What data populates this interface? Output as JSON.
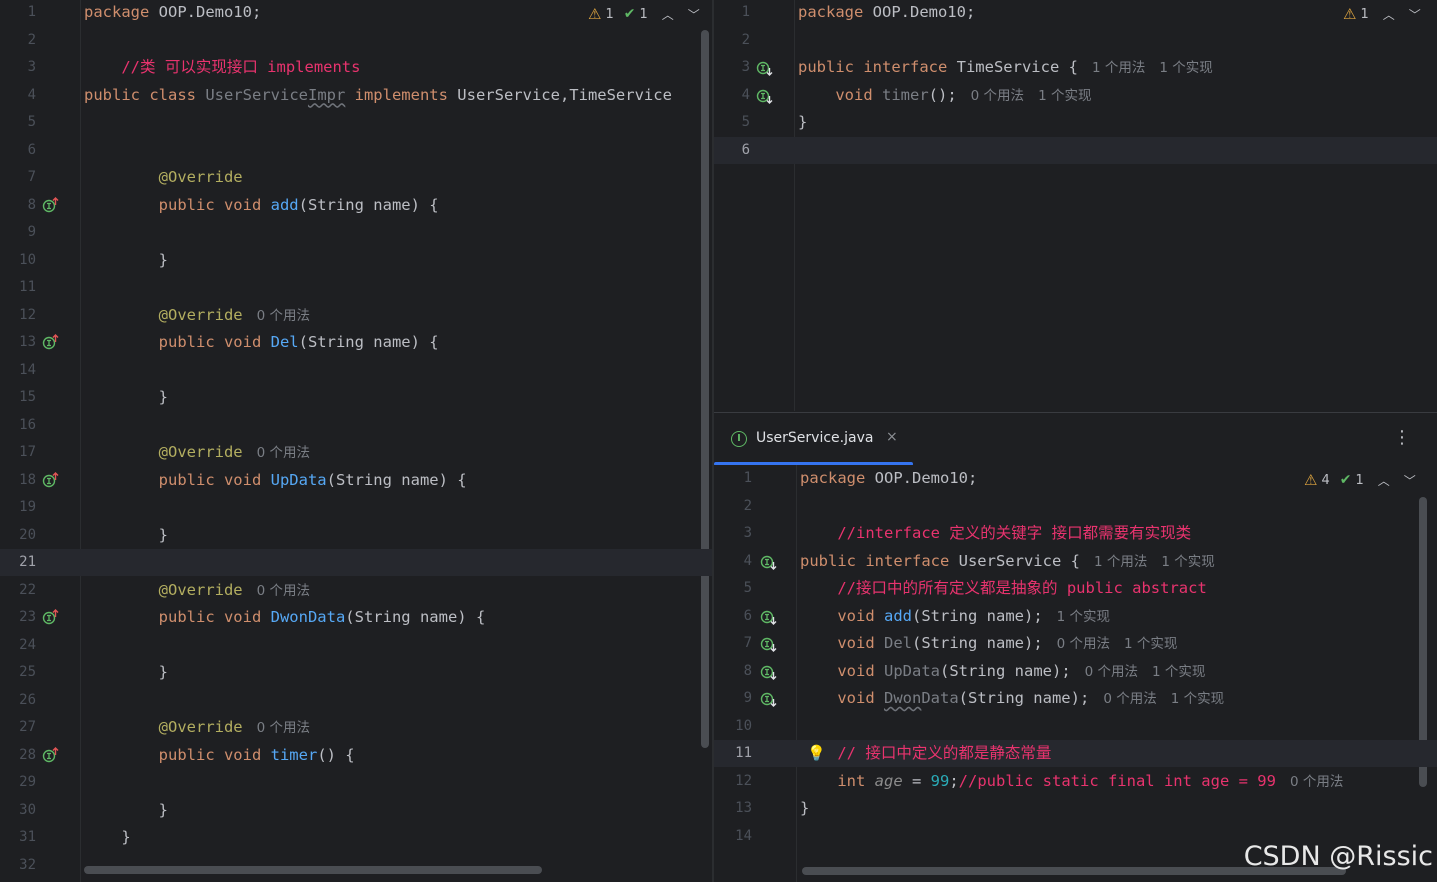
{
  "left_editor": {
    "inspections": {
      "warnings": "1",
      "checks": "1"
    },
    "lines": [
      {
        "n": "1",
        "tokens": [
          [
            "kw",
            "package "
          ],
          [
            "",
            "OOP.Demo10;"
          ]
        ]
      },
      {
        "n": "2",
        "tokens": []
      },
      {
        "n": "3",
        "indent": "    ",
        "tokens": [
          [
            "cm",
            "//类 可以实现接口 implements"
          ]
        ]
      },
      {
        "n": "4",
        "tokens": [
          [
            "kw",
            "public class "
          ],
          [
            "gray",
            "UserService"
          ],
          [
            "gray uw",
            "Impr"
          ],
          [
            "kw",
            " implements "
          ],
          [
            "",
            "UserService,TimeService"
          ]
        ]
      },
      {
        "n": "5",
        "tokens": []
      },
      {
        "n": "6",
        "tokens": []
      },
      {
        "n": "7",
        "indent": "        ",
        "tokens": [
          [
            "ann",
            "@Override"
          ]
        ]
      },
      {
        "n": "8",
        "indent": "        ",
        "icon": "override",
        "tokens": [
          [
            "kw",
            "public void "
          ],
          [
            "fn",
            "add"
          ],
          [
            "",
            "(String name) {"
          ]
        ]
      },
      {
        "n": "9",
        "tokens": []
      },
      {
        "n": "10",
        "indent": "        ",
        "tokens": [
          [
            "",
            "}"
          ]
        ]
      },
      {
        "n": "11",
        "tokens": []
      },
      {
        "n": "12",
        "indent": "        ",
        "tokens": [
          [
            "ann",
            "@Override"
          ]
        ],
        "hints": [
          "0 个用法"
        ]
      },
      {
        "n": "13",
        "indent": "        ",
        "icon": "override",
        "tokens": [
          [
            "kw",
            "public void "
          ],
          [
            "fn",
            "Del"
          ],
          [
            "",
            "(String name) {"
          ]
        ]
      },
      {
        "n": "14",
        "tokens": []
      },
      {
        "n": "15",
        "indent": "        ",
        "tokens": [
          [
            "",
            "}"
          ]
        ]
      },
      {
        "n": "16",
        "tokens": []
      },
      {
        "n": "17",
        "indent": "        ",
        "tokens": [
          [
            "ann",
            "@Override"
          ]
        ],
        "hints": [
          "0 个用法"
        ]
      },
      {
        "n": "18",
        "indent": "        ",
        "icon": "override",
        "tokens": [
          [
            "kw",
            "public void "
          ],
          [
            "fn",
            "UpData"
          ],
          [
            "",
            "(String name) {"
          ]
        ]
      },
      {
        "n": "19",
        "tokens": []
      },
      {
        "n": "20",
        "indent": "        ",
        "tokens": [
          [
            "",
            "}"
          ]
        ]
      },
      {
        "n": "21",
        "hl": true,
        "tokens": []
      },
      {
        "n": "22",
        "indent": "        ",
        "tokens": [
          [
            "ann",
            "@Override"
          ]
        ],
        "hints": [
          "0 个用法"
        ]
      },
      {
        "n": "23",
        "indent": "        ",
        "icon": "override",
        "tokens": [
          [
            "kw",
            "public void "
          ],
          [
            "fn",
            "DwonData"
          ],
          [
            "",
            "(String name) {"
          ]
        ]
      },
      {
        "n": "24",
        "tokens": []
      },
      {
        "n": "25",
        "indent": "        ",
        "tokens": [
          [
            "",
            "}"
          ]
        ]
      },
      {
        "n": "26",
        "tokens": []
      },
      {
        "n": "27",
        "indent": "        ",
        "tokens": [
          [
            "ann",
            "@Override"
          ]
        ],
        "hints": [
          "0 个用法"
        ]
      },
      {
        "n": "28",
        "indent": "        ",
        "icon": "override",
        "tokens": [
          [
            "kw",
            "public void "
          ],
          [
            "fn",
            "timer"
          ],
          [
            "",
            "() {"
          ]
        ]
      },
      {
        "n": "29",
        "tokens": []
      },
      {
        "n": "30",
        "indent": "        ",
        "tokens": [
          [
            "",
            "}"
          ]
        ]
      },
      {
        "n": "31",
        "indent": "    ",
        "tokens": [
          [
            "",
            "}"
          ]
        ]
      },
      {
        "n": "32",
        "tokens": []
      }
    ]
  },
  "top_right_editor": {
    "inspections": {
      "warnings": "1"
    },
    "lines": [
      {
        "n": "1",
        "tokens": [
          [
            "kw",
            "package "
          ],
          [
            "",
            "OOP.Demo10;"
          ]
        ]
      },
      {
        "n": "2",
        "tokens": []
      },
      {
        "n": "3",
        "icon": "implemented",
        "tokens": [
          [
            "kw",
            "public interface "
          ],
          [
            "",
            "TimeService {"
          ]
        ],
        "hints": [
          "1 个用法",
          "1 个实现"
        ]
      },
      {
        "n": "4",
        "indent": "    ",
        "icon": "implemented",
        "tokens": [
          [
            "kw",
            "void "
          ],
          [
            "gray",
            "timer"
          ],
          [
            "",
            "();"
          ]
        ],
        "hints": [
          "0 个用法",
          "1 个实现"
        ]
      },
      {
        "n": "5",
        "tokens": [
          [
            "",
            "}"
          ]
        ]
      },
      {
        "n": "6",
        "hl": true,
        "tokens": []
      }
    ]
  },
  "bottom_right_editor": {
    "tab": {
      "filename": "UserService.java",
      "close": "×",
      "icon_letter": "I"
    },
    "menu_icon": "⋮",
    "inspections": {
      "warnings": "4",
      "checks": "1"
    },
    "lines": [
      {
        "n": "1",
        "tokens": [
          [
            "kw",
            "package "
          ],
          [
            "",
            "OOP.Demo10;"
          ]
        ]
      },
      {
        "n": "2",
        "tokens": []
      },
      {
        "n": "3",
        "indent": "    ",
        "tokens": [
          [
            "cm",
            "//interface 定义的关键字 接口都需要有实现类"
          ]
        ]
      },
      {
        "n": "4",
        "icon": "implemented",
        "tokens": [
          [
            "kw",
            "public interface "
          ],
          [
            "",
            "UserService {"
          ]
        ],
        "hints": [
          "1 个用法",
          "1 个实现"
        ]
      },
      {
        "n": "5",
        "indent": "    ",
        "tokens": [
          [
            "cm",
            "//接口中的所有定义都是抽象的 public abstract"
          ]
        ]
      },
      {
        "n": "6",
        "indent": "    ",
        "icon": "implemented",
        "tokens": [
          [
            "kw",
            "void "
          ],
          [
            "fn",
            "add"
          ],
          [
            "",
            "(String name);"
          ]
        ],
        "hints": [
          "1 个实现"
        ]
      },
      {
        "n": "7",
        "indent": "    ",
        "icon": "implemented",
        "tokens": [
          [
            "kw",
            "void "
          ],
          [
            "gray",
            "Del"
          ],
          [
            "",
            "(String name);"
          ]
        ],
        "hints": [
          "0 个用法",
          "1 个实现"
        ]
      },
      {
        "n": "8",
        "indent": "    ",
        "icon": "implemented",
        "tokens": [
          [
            "kw",
            "void "
          ],
          [
            "gray",
            "UpData"
          ],
          [
            "",
            "(String name);"
          ]
        ],
        "hints": [
          "0 个用法",
          "1 个实现"
        ]
      },
      {
        "n": "9",
        "indent": "    ",
        "icon": "implemented",
        "tokens": [
          [
            "kw",
            "void "
          ],
          [
            "gray uw",
            "Dwon"
          ],
          [
            "gray",
            "Data"
          ],
          [
            "",
            "(String name);"
          ]
        ],
        "hints": [
          "0 个用法",
          "1 个实现"
        ]
      },
      {
        "n": "10",
        "tokens": []
      },
      {
        "n": "11",
        "hl": true,
        "indent": "    ",
        "bulb": true,
        "tokens": [
          [
            "cm",
            "// 接口中定义的都是静态常量"
          ]
        ]
      },
      {
        "n": "12",
        "indent": "    ",
        "tokens": [
          [
            "kw",
            "int "
          ],
          [
            "it",
            "age"
          ],
          [
            "",
            " = "
          ],
          [
            "num",
            "99"
          ],
          [
            "",
            ";"
          ],
          [
            "cm",
            "//public static final int age = 99"
          ]
        ],
        "hints": [
          "0 个用法"
        ]
      },
      {
        "n": "13",
        "tokens": [
          [
            "",
            "}"
          ]
        ]
      },
      {
        "n": "14",
        "tokens": []
      }
    ]
  },
  "watermark": "CSDN @Rissic"
}
